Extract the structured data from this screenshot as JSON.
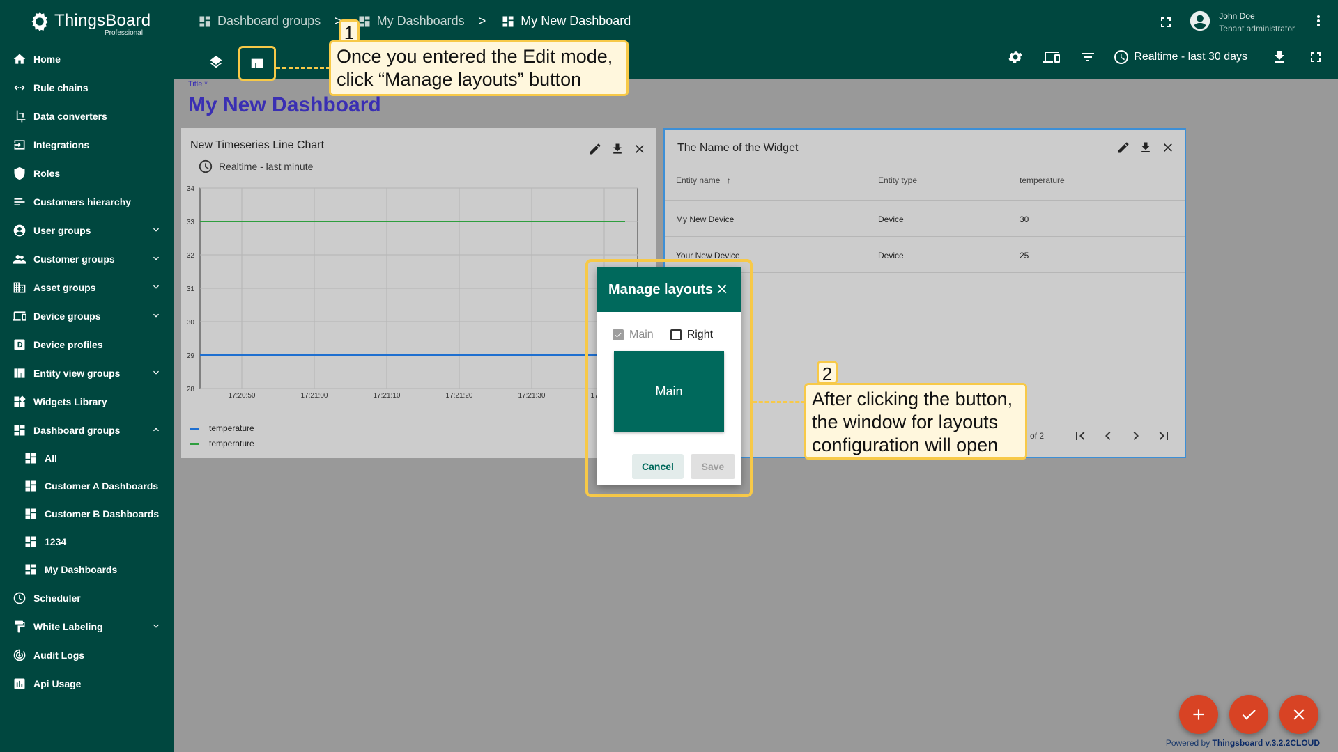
{
  "app": {
    "brand": "ThingsBoard",
    "edition": "Professional"
  },
  "sidebar": {
    "items": [
      {
        "label": "Home",
        "icon": "home-icon"
      },
      {
        "label": "Rule chains",
        "icon": "rule-chains-icon"
      },
      {
        "label": "Data converters",
        "icon": "data-converters-icon"
      },
      {
        "label": "Integrations",
        "icon": "integrations-icon"
      },
      {
        "label": "Roles",
        "icon": "shield-icon"
      },
      {
        "label": "Customers hierarchy",
        "icon": "hierarchy-icon"
      },
      {
        "label": "User groups",
        "icon": "account-circle-icon",
        "expandable": true
      },
      {
        "label": "Customer groups",
        "icon": "people-icon",
        "expandable": true
      },
      {
        "label": "Asset groups",
        "icon": "domain-icon",
        "expandable": true
      },
      {
        "label": "Device groups",
        "icon": "devices-icon",
        "expandable": true
      },
      {
        "label": "Device profiles",
        "icon": "device-profile-icon"
      },
      {
        "label": "Entity view groups",
        "icon": "view-quilt-icon",
        "expandable": true
      },
      {
        "label": "Widgets Library",
        "icon": "widgets-icon"
      },
      {
        "label": "Dashboard groups",
        "icon": "dashboard-icon",
        "expanded": true
      }
    ],
    "dashboard_subitems": [
      {
        "label": "All"
      },
      {
        "label": "Customer A Dashboards"
      },
      {
        "label": "Customer B Dashboards"
      },
      {
        "label": "1234"
      },
      {
        "label": "My Dashboards"
      }
    ],
    "bottom_items": [
      {
        "label": "Scheduler",
        "icon": "schedule-icon"
      },
      {
        "label": "White Labeling",
        "icon": "format-paint-icon",
        "expandable": true
      },
      {
        "label": "Audit Logs",
        "icon": "track-changes-icon"
      },
      {
        "label": "Api Usage",
        "icon": "insert-chart-icon"
      }
    ]
  },
  "breadcrumb": {
    "items": [
      "Dashboard groups",
      "My Dashboards",
      "My New Dashboard"
    ],
    "separator": ">"
  },
  "user": {
    "name": "John Doe",
    "role": "Tenant administrator"
  },
  "toolbar": {
    "timewindow": "Realtime - last 30 days"
  },
  "dashboard": {
    "title_label": "Title *",
    "title": "My New Dashboard"
  },
  "widget_chart": {
    "title": "New Timeseries Line Chart",
    "subtitle": "Realtime - last minute",
    "legend": [
      {
        "name": "temperature",
        "color": "#1e6fd0"
      },
      {
        "name": "temperature",
        "color": "#2e9e3e"
      }
    ]
  },
  "chart_data": {
    "type": "line",
    "x": [
      "17:20:50",
      "17:21:00",
      "17:21:10",
      "17:21:20",
      "17:21:30",
      "17:21:40"
    ],
    "ylim": [
      28,
      34
    ],
    "yticks": [
      34,
      33,
      32,
      31,
      30,
      29,
      28
    ],
    "series": [
      {
        "name": "temperature",
        "color": "#1e6fd0",
        "values": [
          29,
          29,
          29,
          29,
          29,
          29
        ]
      },
      {
        "name": "temperature",
        "color": "#2e9e3e",
        "values": [
          33,
          33,
          33,
          33,
          33,
          33
        ]
      }
    ],
    "grid": true
  },
  "widget_table": {
    "title": "The Name of the Widget",
    "columns": [
      "Entity name",
      "Entity type",
      "temperature"
    ],
    "rows": [
      [
        "My New Device",
        "Device",
        "30"
      ],
      [
        "Your New Device",
        "Device",
        "25"
      ]
    ],
    "pager_text": "of 2"
  },
  "dialog": {
    "title": "Manage layouts",
    "check_main": "Main",
    "check_right": "Right",
    "layout_label": "Main",
    "cancel": "Cancel",
    "save": "Save"
  },
  "callouts": {
    "one_number": "1",
    "one_text_line1": "Once you entered the Edit mode,",
    "one_text_line2": "click “Manage layouts” button",
    "two_number": "2",
    "two_text_line1": "After clicking the button,",
    "two_text_line2": "the window for layouts",
    "two_text_line3": "configuration will open"
  },
  "footer": {
    "powered_prefix": "Powered by ",
    "powered_link": "Thingsboard v.3.2.2CLOUD"
  },
  "colors": {
    "primary": "#00473f",
    "accent": "#00695c",
    "highlight": "#f7c948",
    "title": "#3a2fb3",
    "fab": "#d84324"
  }
}
